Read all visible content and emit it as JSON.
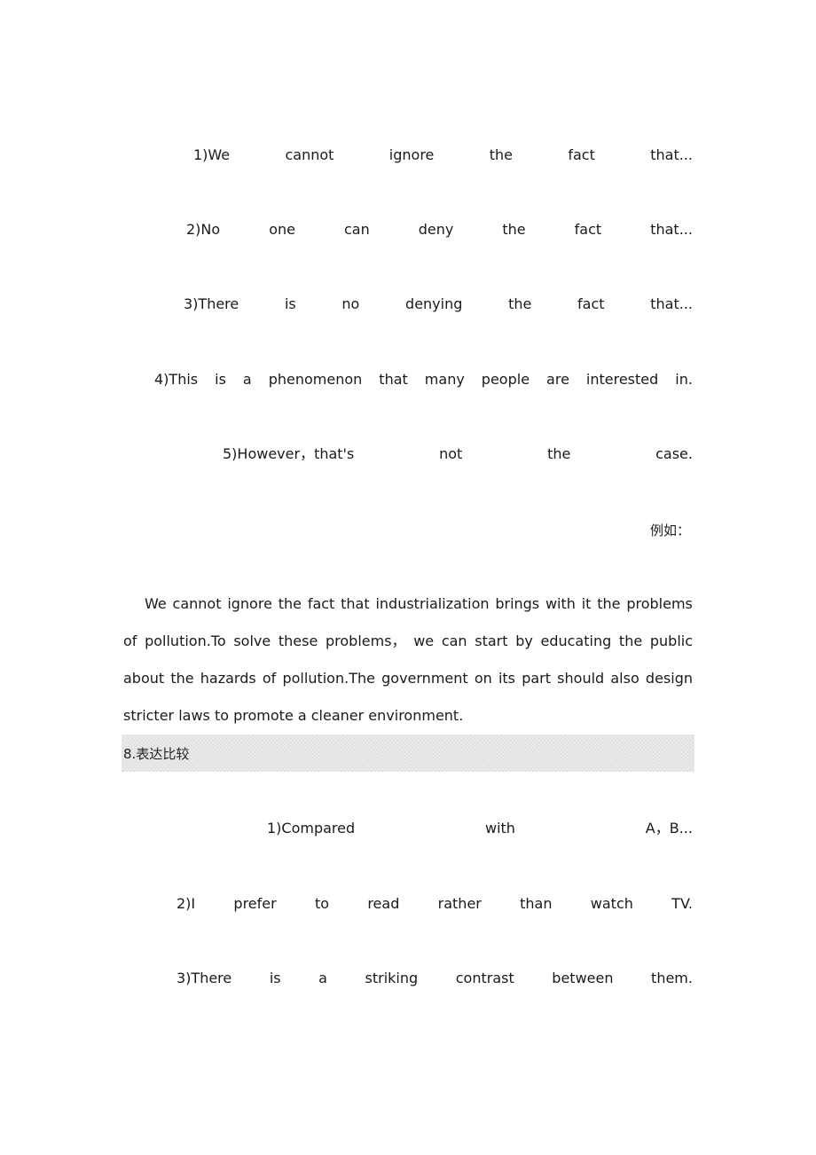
{
  "section7": {
    "phrases": [
      [
        "1)We",
        "cannot",
        "ignore",
        "the",
        "fact",
        "that..."
      ],
      [
        "2)No",
        "one",
        "can",
        "deny",
        "the",
        "fact",
        "that..."
      ],
      [
        "3)There",
        "is",
        "no",
        "denying",
        "the",
        "fact",
        "that..."
      ],
      [
        "4)This",
        "is",
        "a",
        "phenomenon",
        "that",
        "many",
        "people",
        "are",
        "interested",
        "in."
      ],
      [
        "5)However，that's",
        "not",
        "the",
        "case."
      ]
    ],
    "example_label": "例如：",
    "example_lines": [
      "We cannot ignore the fact that industrialization brings with it the problems",
      "of pollution.To solve these problems， we can start by educating the public",
      "about the hazards of pollution.The government on its part should also design",
      "stricter laws to promote a cleaner environment."
    ]
  },
  "section8": {
    "heading_number": "8.",
    "heading_title": "表达比较",
    "phrases": [
      [
        "1)Compared",
        "with",
        "A，B..."
      ],
      [
        "2)I",
        "prefer",
        "to",
        "read",
        "rather",
        "than",
        "watch",
        "TV."
      ],
      [
        "3)There",
        "is",
        "a",
        "striking",
        "contrast",
        "between",
        "them."
      ]
    ]
  },
  "colors": {
    "heading_bar": "#e6e6e6",
    "text": "#1a1a1a"
  }
}
